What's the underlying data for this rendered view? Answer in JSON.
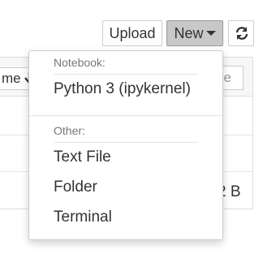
{
  "toolbar": {
    "upload_label": "Upload",
    "new_label": "New",
    "refresh_icon": "refresh-icon"
  },
  "list": {
    "name_header_partial": "me",
    "name_sort_icon": "arrow-down-icon",
    "size_header_partial": "ze",
    "size_value_partial": "2 B"
  },
  "menu": {
    "notebook_header": "Notebook:",
    "notebook_items": [
      "Python 3 (ipykernel)"
    ],
    "other_header": "Other:",
    "other_items": [
      "Text File",
      "Folder",
      "Terminal"
    ]
  },
  "colors": {
    "new_button_active": "#c8c8c8",
    "menu_border": "#cccccc"
  }
}
